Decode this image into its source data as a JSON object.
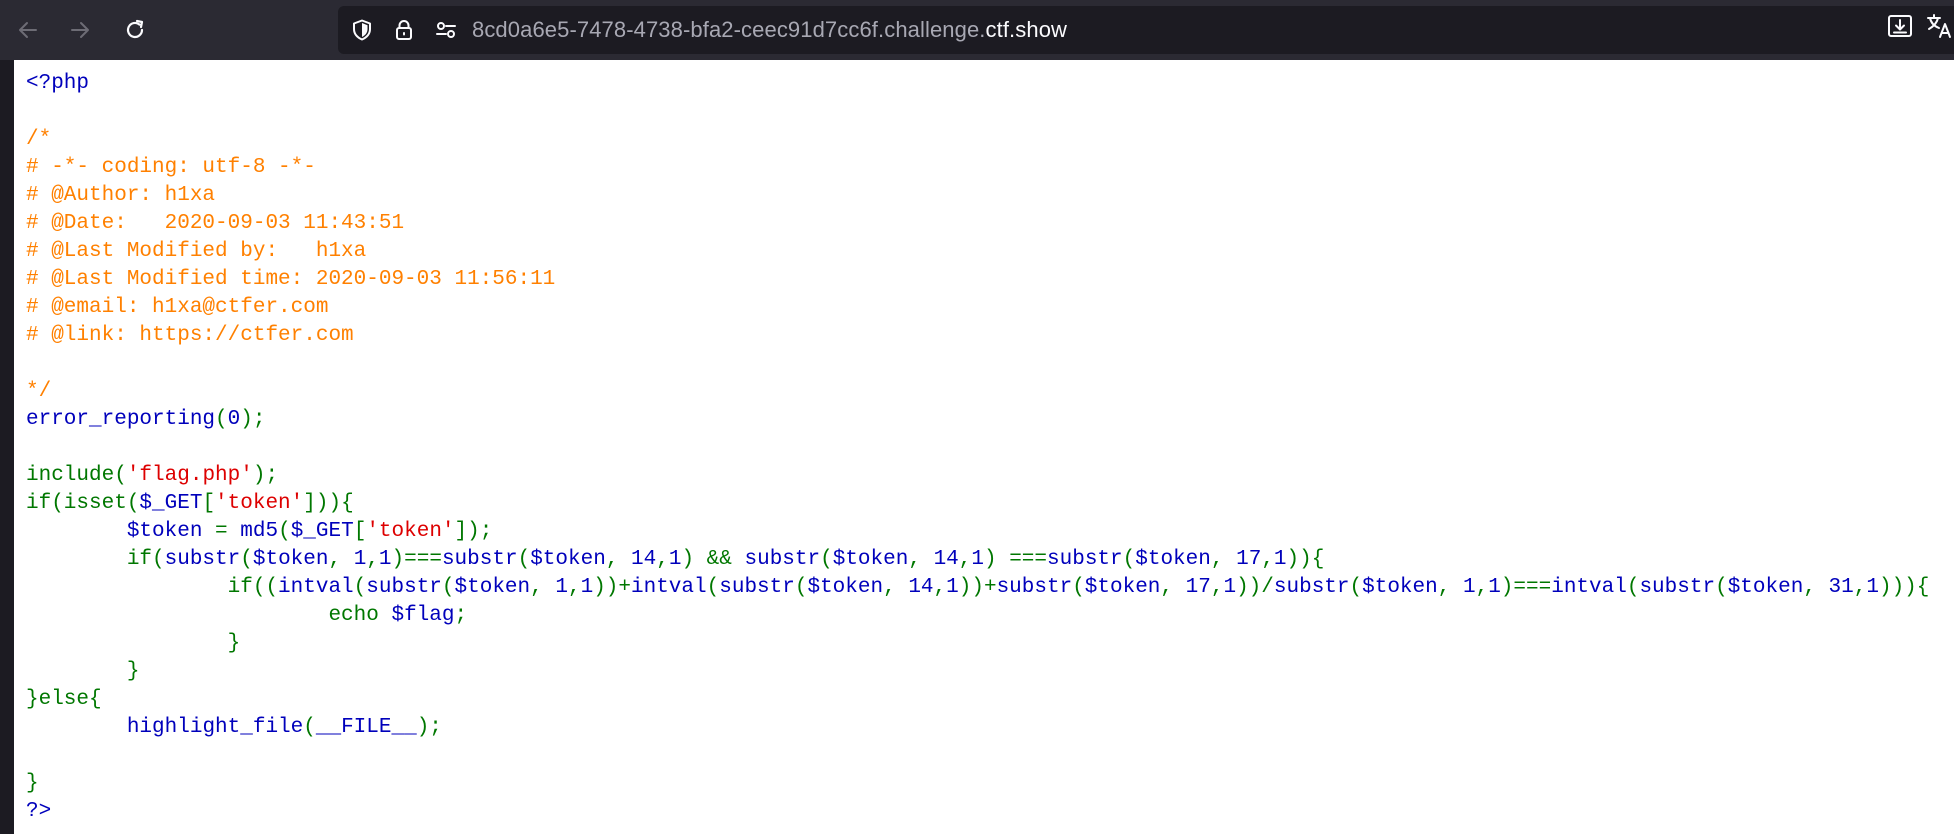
{
  "browser": {
    "url_subdomain": "8cd0a6e5-7478-4738-bfa2-ceec91d7cc6f.challenge.",
    "url_domain": "ctf.show",
    "icons": [
      "back-arrow-icon",
      "forward-arrow-icon",
      "reload-icon",
      "shield-icon",
      "lock-icon",
      "site-permissions-icon",
      "download-icon",
      "translate-icon"
    ]
  },
  "colors": {
    "comment": "#ff8000",
    "default": "#0000bb",
    "keyword": "#007700",
    "string": "#dd0000"
  },
  "code": {
    "lines": [
      [
        {
          "t": "<?php",
          "c": "default"
        }
      ],
      [],
      [
        {
          "t": "/*",
          "c": "comment"
        }
      ],
      [
        {
          "t": "# -*- coding: utf-8 -*-",
          "c": "comment"
        }
      ],
      [
        {
          "t": "# @Author: h1xa",
          "c": "comment"
        }
      ],
      [
        {
          "t": "# @Date:   2020-09-03 11:43:51",
          "c": "comment"
        }
      ],
      [
        {
          "t": "# @Last Modified by:   h1xa",
          "c": "comment"
        }
      ],
      [
        {
          "t": "# @Last Modified time: 2020-09-03 11:56:11",
          "c": "comment"
        }
      ],
      [
        {
          "t": "# @email: h1xa@ctfer.com",
          "c": "comment"
        }
      ],
      [
        {
          "t": "# @link: https://ctfer.com",
          "c": "comment"
        }
      ],
      [],
      [
        {
          "t": "*/",
          "c": "comment"
        }
      ],
      [
        {
          "t": "error_reporting",
          "c": "default"
        },
        {
          "t": "(",
          "c": "keyword"
        },
        {
          "t": "0",
          "c": "default"
        },
        {
          "t": ");",
          "c": "keyword"
        }
      ],
      [],
      [
        {
          "t": "include(",
          "c": "keyword"
        },
        {
          "t": "'flag.php'",
          "c": "string"
        },
        {
          "t": ");",
          "c": "keyword"
        }
      ],
      [
        {
          "t": "if(isset(",
          "c": "keyword"
        },
        {
          "t": "$_GET",
          "c": "default"
        },
        {
          "t": "[",
          "c": "keyword"
        },
        {
          "t": "'token'",
          "c": "string"
        },
        {
          "t": "])){",
          "c": "keyword"
        }
      ],
      [
        {
          "t": "        ",
          "c": "keyword"
        },
        {
          "t": "$token ",
          "c": "default"
        },
        {
          "t": "= ",
          "c": "keyword"
        },
        {
          "t": "md5",
          "c": "default"
        },
        {
          "t": "(",
          "c": "keyword"
        },
        {
          "t": "$_GET",
          "c": "default"
        },
        {
          "t": "[",
          "c": "keyword"
        },
        {
          "t": "'token'",
          "c": "string"
        },
        {
          "t": "]);",
          "c": "keyword"
        }
      ],
      [
        {
          "t": "        if(",
          "c": "keyword"
        },
        {
          "t": "substr",
          "c": "default"
        },
        {
          "t": "(",
          "c": "keyword"
        },
        {
          "t": "$token",
          "c": "default"
        },
        {
          "t": ", ",
          "c": "keyword"
        },
        {
          "t": "1",
          "c": "default"
        },
        {
          "t": ",",
          "c": "keyword"
        },
        {
          "t": "1",
          "c": "default"
        },
        {
          "t": ")===",
          "c": "keyword"
        },
        {
          "t": "substr",
          "c": "default"
        },
        {
          "t": "(",
          "c": "keyword"
        },
        {
          "t": "$token",
          "c": "default"
        },
        {
          "t": ", ",
          "c": "keyword"
        },
        {
          "t": "14",
          "c": "default"
        },
        {
          "t": ",",
          "c": "keyword"
        },
        {
          "t": "1",
          "c": "default"
        },
        {
          "t": ") && ",
          "c": "keyword"
        },
        {
          "t": "substr",
          "c": "default"
        },
        {
          "t": "(",
          "c": "keyword"
        },
        {
          "t": "$token",
          "c": "default"
        },
        {
          "t": ", ",
          "c": "keyword"
        },
        {
          "t": "14",
          "c": "default"
        },
        {
          "t": ",",
          "c": "keyword"
        },
        {
          "t": "1",
          "c": "default"
        },
        {
          "t": ") ===",
          "c": "keyword"
        },
        {
          "t": "substr",
          "c": "default"
        },
        {
          "t": "(",
          "c": "keyword"
        },
        {
          "t": "$token",
          "c": "default"
        },
        {
          "t": ", ",
          "c": "keyword"
        },
        {
          "t": "17",
          "c": "default"
        },
        {
          "t": ",",
          "c": "keyword"
        },
        {
          "t": "1",
          "c": "default"
        },
        {
          "t": ")){",
          "c": "keyword"
        }
      ],
      [
        {
          "t": "                if((",
          "c": "keyword"
        },
        {
          "t": "intval",
          "c": "default"
        },
        {
          "t": "(",
          "c": "keyword"
        },
        {
          "t": "substr",
          "c": "default"
        },
        {
          "t": "(",
          "c": "keyword"
        },
        {
          "t": "$token",
          "c": "default"
        },
        {
          "t": ", ",
          "c": "keyword"
        },
        {
          "t": "1",
          "c": "default"
        },
        {
          "t": ",",
          "c": "keyword"
        },
        {
          "t": "1",
          "c": "default"
        },
        {
          "t": "))+",
          "c": "keyword"
        },
        {
          "t": "intval",
          "c": "default"
        },
        {
          "t": "(",
          "c": "keyword"
        },
        {
          "t": "substr",
          "c": "default"
        },
        {
          "t": "(",
          "c": "keyword"
        },
        {
          "t": "$token",
          "c": "default"
        },
        {
          "t": ", ",
          "c": "keyword"
        },
        {
          "t": "14",
          "c": "default"
        },
        {
          "t": ",",
          "c": "keyword"
        },
        {
          "t": "1",
          "c": "default"
        },
        {
          "t": "))+",
          "c": "keyword"
        },
        {
          "t": "substr",
          "c": "default"
        },
        {
          "t": "(",
          "c": "keyword"
        },
        {
          "t": "$token",
          "c": "default"
        },
        {
          "t": ", ",
          "c": "keyword"
        },
        {
          "t": "17",
          "c": "default"
        },
        {
          "t": ",",
          "c": "keyword"
        },
        {
          "t": "1",
          "c": "default"
        },
        {
          "t": "))/",
          "c": "keyword"
        },
        {
          "t": "substr",
          "c": "default"
        },
        {
          "t": "(",
          "c": "keyword"
        },
        {
          "t": "$token",
          "c": "default"
        },
        {
          "t": ", ",
          "c": "keyword"
        },
        {
          "t": "1",
          "c": "default"
        },
        {
          "t": ",",
          "c": "keyword"
        },
        {
          "t": "1",
          "c": "default"
        },
        {
          "t": ")===",
          "c": "keyword"
        },
        {
          "t": "intval",
          "c": "default"
        },
        {
          "t": "(",
          "c": "keyword"
        },
        {
          "t": "substr",
          "c": "default"
        },
        {
          "t": "(",
          "c": "keyword"
        },
        {
          "t": "$token",
          "c": "default"
        },
        {
          "t": ", ",
          "c": "keyword"
        },
        {
          "t": "31",
          "c": "default"
        },
        {
          "t": ",",
          "c": "keyword"
        },
        {
          "t": "1",
          "c": "default"
        },
        {
          "t": "))){",
          "c": "keyword"
        }
      ],
      [
        {
          "t": "                        echo ",
          "c": "keyword"
        },
        {
          "t": "$flag",
          "c": "default"
        },
        {
          "t": ";",
          "c": "keyword"
        }
      ],
      [
        {
          "t": "                }",
          "c": "keyword"
        }
      ],
      [
        {
          "t": "        }",
          "c": "keyword"
        }
      ],
      [
        {
          "t": "}else{",
          "c": "keyword"
        }
      ],
      [
        {
          "t": "        ",
          "c": "keyword"
        },
        {
          "t": "highlight_file",
          "c": "default"
        },
        {
          "t": "(",
          "c": "keyword"
        },
        {
          "t": "__FILE__",
          "c": "default"
        },
        {
          "t": ");",
          "c": "keyword"
        }
      ],
      [],
      [
        {
          "t": "}",
          "c": "keyword"
        }
      ],
      [
        {
          "t": "?>",
          "c": "default"
        }
      ]
    ]
  }
}
